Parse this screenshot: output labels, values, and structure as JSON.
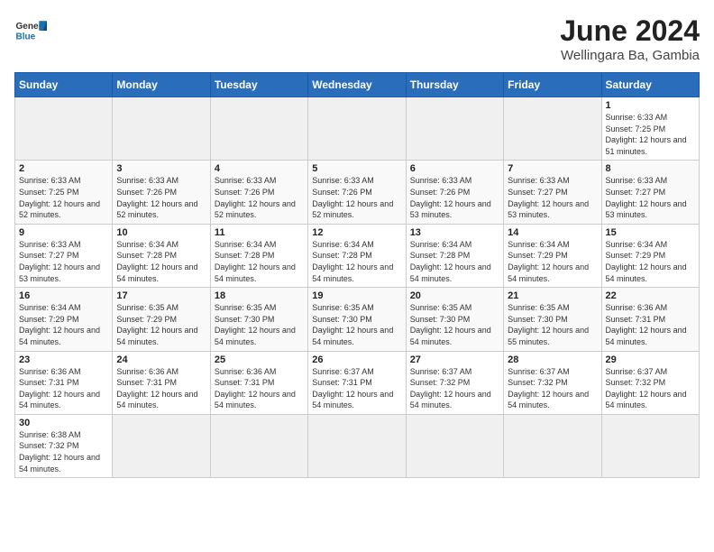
{
  "logo": {
    "text_general": "General",
    "text_blue": "Blue"
  },
  "title": "June 2024",
  "subtitle": "Wellingara Ba, Gambia",
  "days_of_week": [
    "Sunday",
    "Monday",
    "Tuesday",
    "Wednesday",
    "Thursday",
    "Friday",
    "Saturday"
  ],
  "weeks": [
    [
      {
        "day": "",
        "info": ""
      },
      {
        "day": "",
        "info": ""
      },
      {
        "day": "",
        "info": ""
      },
      {
        "day": "",
        "info": ""
      },
      {
        "day": "",
        "info": ""
      },
      {
        "day": "",
        "info": ""
      },
      {
        "day": "1",
        "info": "Sunrise: 6:33 AM\nSunset: 7:25 PM\nDaylight: 12 hours and 51 minutes."
      }
    ],
    [
      {
        "day": "2",
        "info": "Sunrise: 6:33 AM\nSunset: 7:25 PM\nDaylight: 12 hours and 52 minutes."
      },
      {
        "day": "3",
        "info": "Sunrise: 6:33 AM\nSunset: 7:26 PM\nDaylight: 12 hours and 52 minutes."
      },
      {
        "day": "4",
        "info": "Sunrise: 6:33 AM\nSunset: 7:26 PM\nDaylight: 12 hours and 52 minutes."
      },
      {
        "day": "5",
        "info": "Sunrise: 6:33 AM\nSunset: 7:26 PM\nDaylight: 12 hours and 52 minutes."
      },
      {
        "day": "6",
        "info": "Sunrise: 6:33 AM\nSunset: 7:26 PM\nDaylight: 12 hours and 53 minutes."
      },
      {
        "day": "7",
        "info": "Sunrise: 6:33 AM\nSunset: 7:27 PM\nDaylight: 12 hours and 53 minutes."
      },
      {
        "day": "8",
        "info": "Sunrise: 6:33 AM\nSunset: 7:27 PM\nDaylight: 12 hours and 53 minutes."
      }
    ],
    [
      {
        "day": "9",
        "info": "Sunrise: 6:33 AM\nSunset: 7:27 PM\nDaylight: 12 hours and 53 minutes."
      },
      {
        "day": "10",
        "info": "Sunrise: 6:34 AM\nSunset: 7:28 PM\nDaylight: 12 hours and 54 minutes."
      },
      {
        "day": "11",
        "info": "Sunrise: 6:34 AM\nSunset: 7:28 PM\nDaylight: 12 hours and 54 minutes."
      },
      {
        "day": "12",
        "info": "Sunrise: 6:34 AM\nSunset: 7:28 PM\nDaylight: 12 hours and 54 minutes."
      },
      {
        "day": "13",
        "info": "Sunrise: 6:34 AM\nSunset: 7:28 PM\nDaylight: 12 hours and 54 minutes."
      },
      {
        "day": "14",
        "info": "Sunrise: 6:34 AM\nSunset: 7:29 PM\nDaylight: 12 hours and 54 minutes."
      },
      {
        "day": "15",
        "info": "Sunrise: 6:34 AM\nSunset: 7:29 PM\nDaylight: 12 hours and 54 minutes."
      }
    ],
    [
      {
        "day": "16",
        "info": "Sunrise: 6:34 AM\nSunset: 7:29 PM\nDaylight: 12 hours and 54 minutes."
      },
      {
        "day": "17",
        "info": "Sunrise: 6:35 AM\nSunset: 7:29 PM\nDaylight: 12 hours and 54 minutes."
      },
      {
        "day": "18",
        "info": "Sunrise: 6:35 AM\nSunset: 7:30 PM\nDaylight: 12 hours and 54 minutes."
      },
      {
        "day": "19",
        "info": "Sunrise: 6:35 AM\nSunset: 7:30 PM\nDaylight: 12 hours and 54 minutes."
      },
      {
        "day": "20",
        "info": "Sunrise: 6:35 AM\nSunset: 7:30 PM\nDaylight: 12 hours and 54 minutes."
      },
      {
        "day": "21",
        "info": "Sunrise: 6:35 AM\nSunset: 7:30 PM\nDaylight: 12 hours and 55 minutes."
      },
      {
        "day": "22",
        "info": "Sunrise: 6:36 AM\nSunset: 7:31 PM\nDaylight: 12 hours and 54 minutes."
      }
    ],
    [
      {
        "day": "23",
        "info": "Sunrise: 6:36 AM\nSunset: 7:31 PM\nDaylight: 12 hours and 54 minutes."
      },
      {
        "day": "24",
        "info": "Sunrise: 6:36 AM\nSunset: 7:31 PM\nDaylight: 12 hours and 54 minutes."
      },
      {
        "day": "25",
        "info": "Sunrise: 6:36 AM\nSunset: 7:31 PM\nDaylight: 12 hours and 54 minutes."
      },
      {
        "day": "26",
        "info": "Sunrise: 6:37 AM\nSunset: 7:31 PM\nDaylight: 12 hours and 54 minutes."
      },
      {
        "day": "27",
        "info": "Sunrise: 6:37 AM\nSunset: 7:32 PM\nDaylight: 12 hours and 54 minutes."
      },
      {
        "day": "28",
        "info": "Sunrise: 6:37 AM\nSunset: 7:32 PM\nDaylight: 12 hours and 54 minutes."
      },
      {
        "day": "29",
        "info": "Sunrise: 6:37 AM\nSunset: 7:32 PM\nDaylight: 12 hours and 54 minutes."
      }
    ],
    [
      {
        "day": "30",
        "info": "Sunrise: 6:38 AM\nSunset: 7:32 PM\nDaylight: 12 hours and 54 minutes."
      },
      {
        "day": "",
        "info": ""
      },
      {
        "day": "",
        "info": ""
      },
      {
        "day": "",
        "info": ""
      },
      {
        "day": "",
        "info": ""
      },
      {
        "day": "",
        "info": ""
      },
      {
        "day": "",
        "info": ""
      }
    ]
  ]
}
